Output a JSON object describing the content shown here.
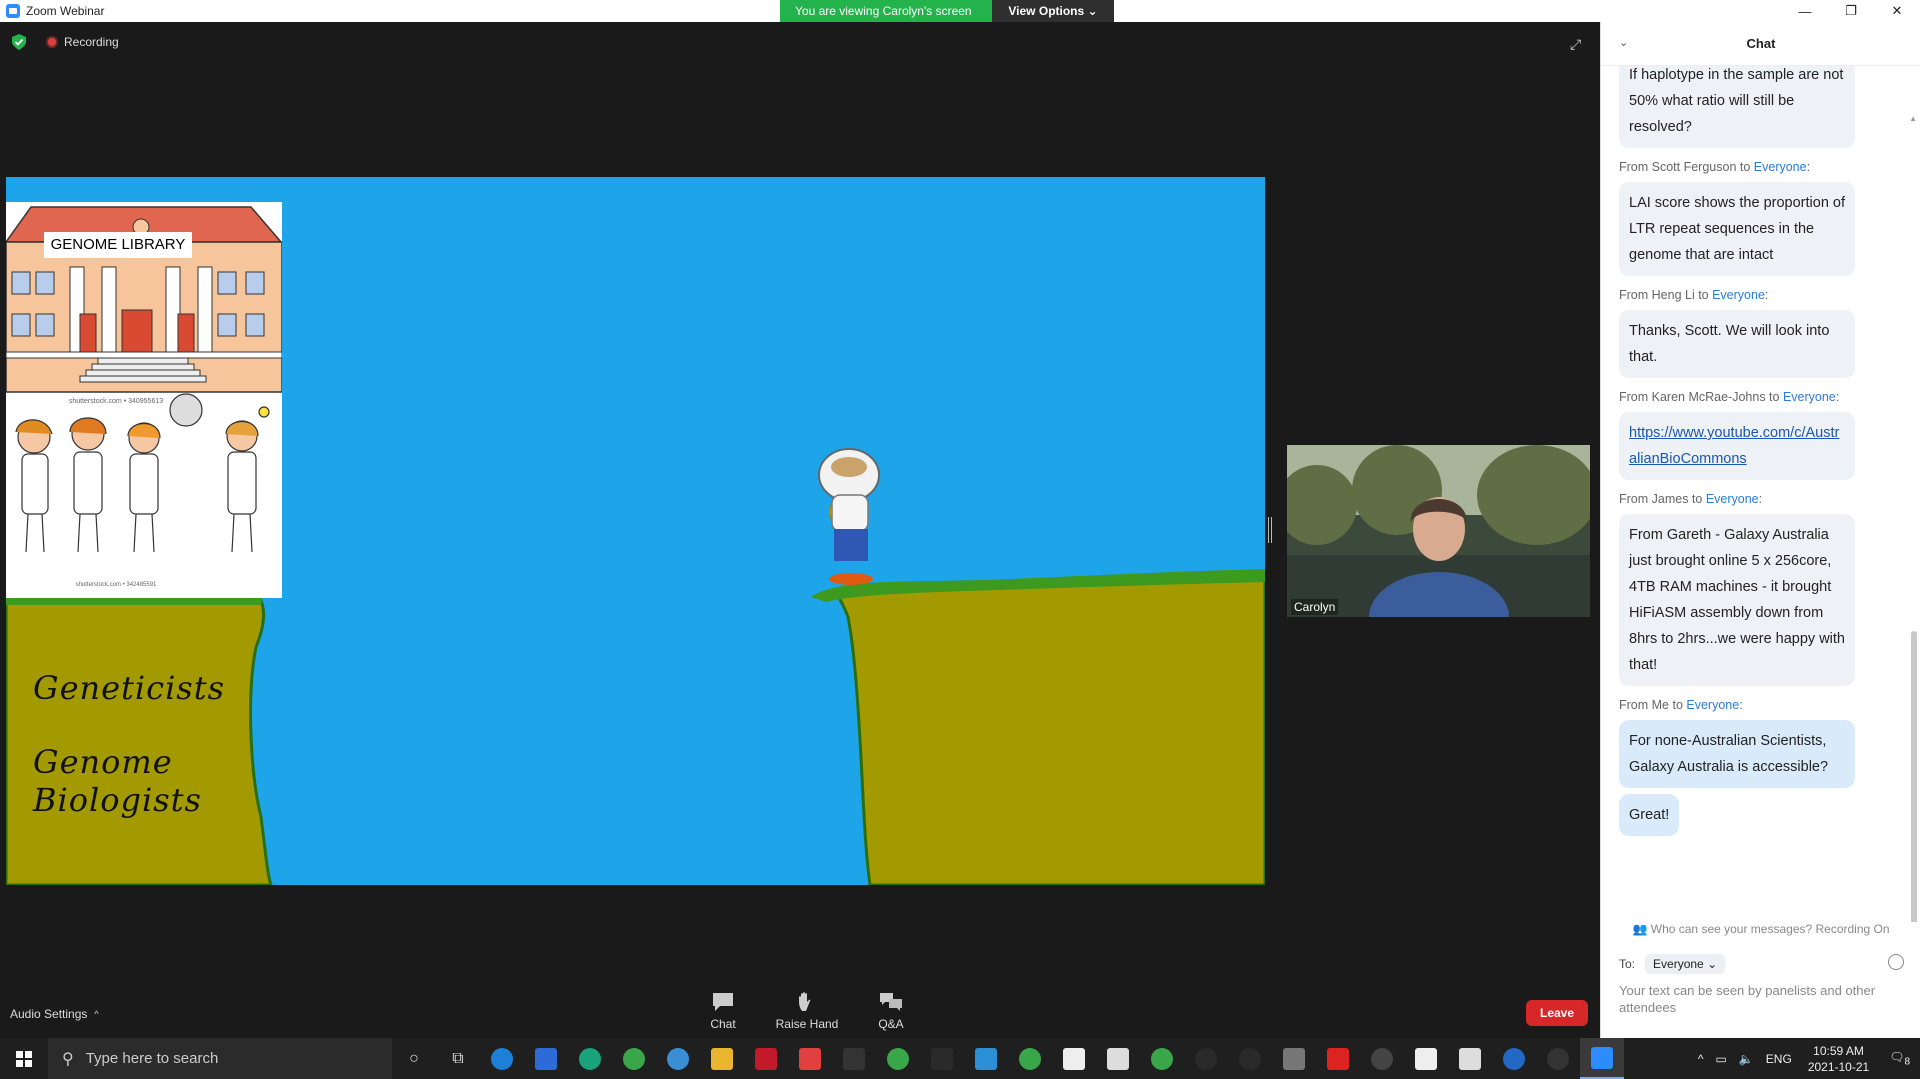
{
  "window": {
    "title": "Zoom Webinar",
    "controls": [
      "—",
      "❐",
      "✕"
    ]
  },
  "banner": {
    "viewing": "You are viewing Carolyn's screen",
    "view_options": "View Options"
  },
  "recording": "Recording",
  "slide": {
    "genome_library": "GENOME LIBRARY",
    "shutter1": "shutterstock.com • 340955613",
    "shutter2": "shutterstock.com • 342485591",
    "geneticists": "Geneticists",
    "genome_biologists": "Genome Biologists"
  },
  "video": {
    "name": "Carolyn"
  },
  "toolbar": {
    "audio_settings": "Audio Settings",
    "chat": "Chat",
    "raise_hand": "Raise Hand",
    "qa": "Q&A",
    "leave": "Leave"
  },
  "chat": {
    "title": "Chat",
    "partial_message": "If haplotype in the sample are not 50% what ratio will still be resolved?",
    "messages": [
      {
        "from": "From Scott Ferguson to ",
        "to": "Everyone",
        "text": "LAI score shows the proportion of LTR repeat sequences in the genome that are intact"
      },
      {
        "from": "From Heng Li to ",
        "to": "Everyone",
        "text": "Thanks, Scott. We will look into that."
      },
      {
        "from": "From Karen McRae-Johns to ",
        "to": "Everyone",
        "text": "https://www.youtube.com/c/AustralianBioCommons"
      },
      {
        "from": "From James to ",
        "to": "Everyone",
        "text": "From Gareth - Galaxy Australia just brought online 5 x 256core, 4TB RAM machines - it brought HiFiASM assembly down from 8hrs to 2hrs...we were happy with that!"
      },
      {
        "from": "From Me to ",
        "to": "Everyone",
        "text": "For none-Australian Scientists, Galaxy Australia is accessible?",
        "text2": "Great!"
      }
    ],
    "who_can_see": "Who can see your messages? Recording On",
    "to_label": "To:",
    "to_value": "Everyone",
    "input_placeholder": "Your text can be seen by panelists and other attendees"
  },
  "taskbar": {
    "search_placeholder": "Type here to search",
    "lang": "ENG",
    "time": "10:59 AM",
    "date": "2021-10-21",
    "notifications": "8"
  },
  "colors": {
    "sky": "#1ea4e8",
    "ground": "#a29a00",
    "grass": "#3d9a1e",
    "banner_green": "#24b24c",
    "leave_red": "#d62828",
    "link_blue": "#2c7bd6"
  }
}
